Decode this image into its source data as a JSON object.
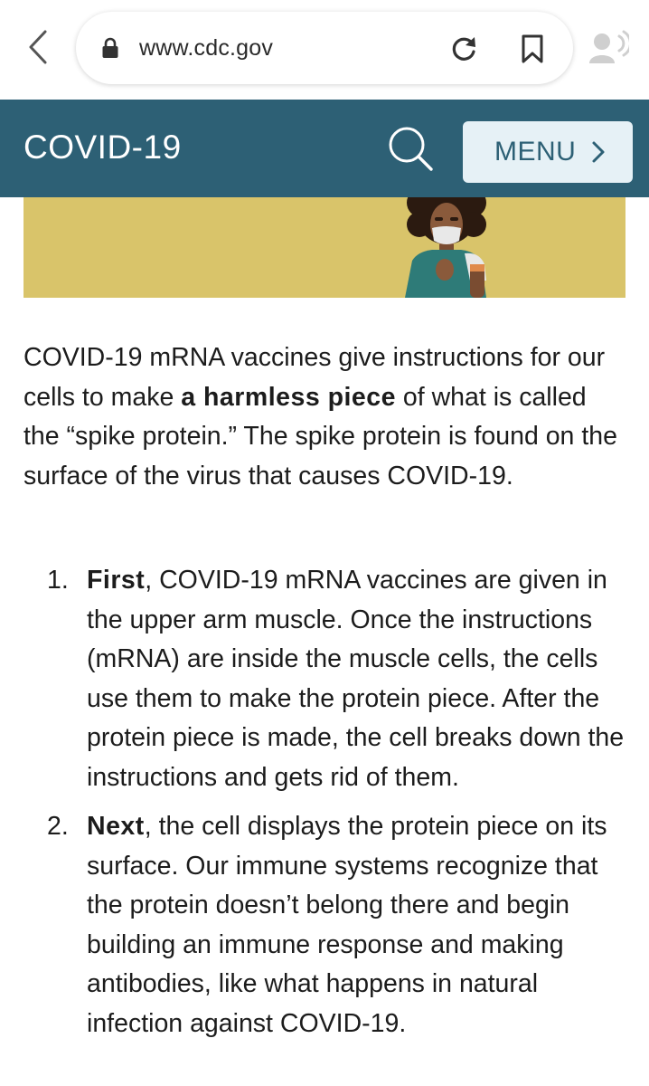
{
  "browser": {
    "url": "www.cdc.gov"
  },
  "header": {
    "title": "COVID-19",
    "menu_label": "MENU"
  },
  "article": {
    "intro_before": "COVID-19 mRNA vaccines give instructions for our cells to make ",
    "intro_bold": "a harmless piece",
    "intro_after": " of what is called the “spike protein.” The spike protein is found on the surface of the virus that causes COVID-19.",
    "steps": [
      {
        "number": "1.",
        "lead": "First",
        "text": ", COVID-19 mRNA vaccines are given in the upper arm muscle. Once the instructions (mRNA) are inside the muscle cells, the cells use them to make the protein piece. After the protein piece is made, the cell breaks down the instructions and gets rid of them."
      },
      {
        "number": "2.",
        "lead": "Next",
        "text": ", the cell displays the protein piece on its surface. Our immune systems recognize that the protein doesn’t belong there and begin building an immune response and making antibodies, like what happens in natural infection against COVID-19."
      }
    ]
  },
  "colors": {
    "header_bg": "#2d6075",
    "menu_bg": "#e6f1f6",
    "banner_bg": "#d9c46a"
  }
}
